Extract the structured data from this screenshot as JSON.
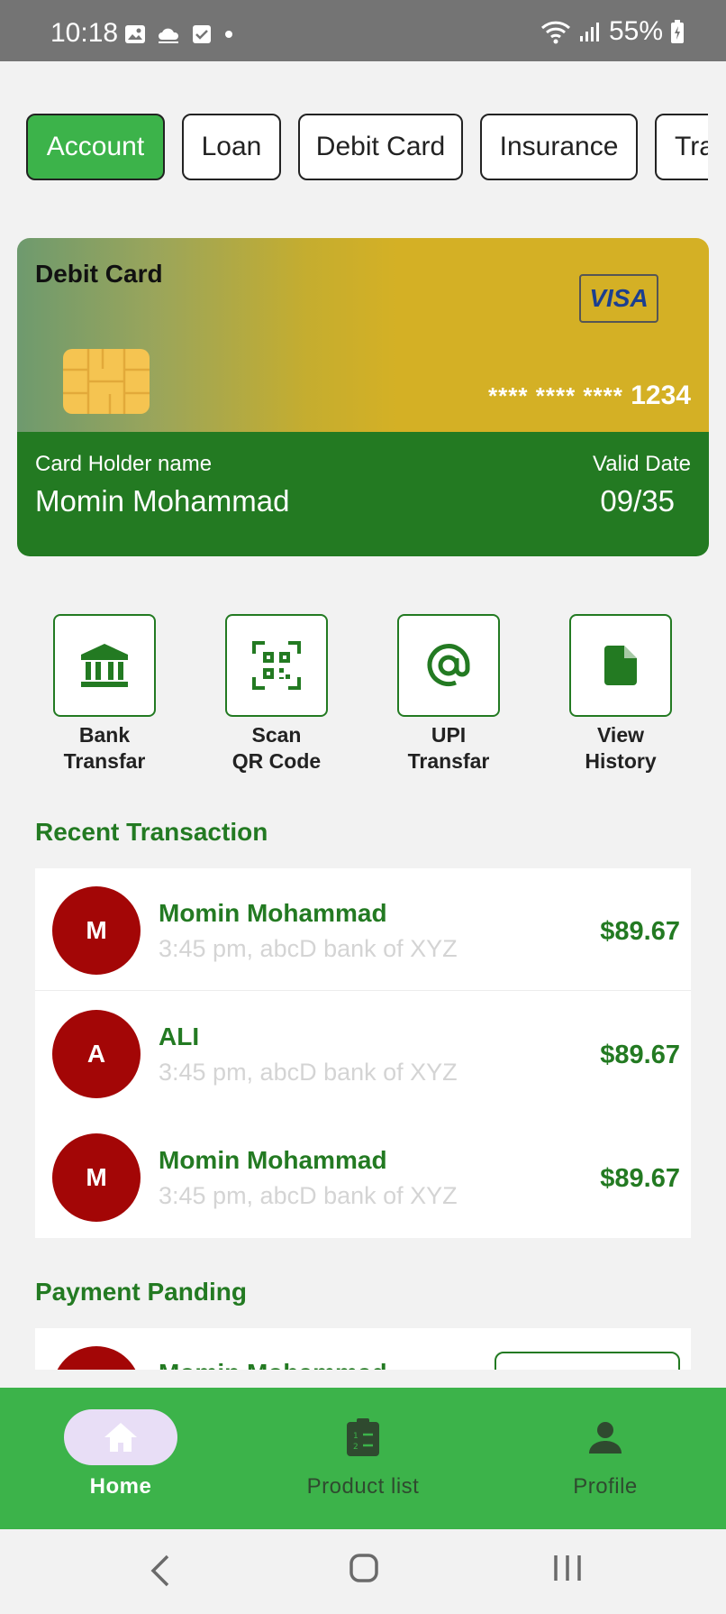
{
  "status_bar": {
    "time": "10:18",
    "battery": "55%"
  },
  "tabs": [
    {
      "label": "Account"
    },
    {
      "label": "Loan"
    },
    {
      "label": "Debit Card"
    },
    {
      "label": "Insurance"
    },
    {
      "label": "Tra"
    }
  ],
  "card": {
    "title": "Debit Card",
    "brand": "VISA",
    "masked": "**** **** ****",
    "last4": "1234",
    "holder_label": "Card Holder name",
    "holder_name": "Momin Mohammad",
    "valid_label": "Valid Date",
    "valid_value": "09/35"
  },
  "actions": [
    {
      "label": "Bank\nTransfar",
      "icon": "bank-icon"
    },
    {
      "label": "Scan\nQR Code",
      "icon": "qr-code-icon"
    },
    {
      "label": "UPI\nTransfar",
      "icon": "at-icon"
    },
    {
      "label": "View\nHistory",
      "icon": "file-icon"
    }
  ],
  "recent": {
    "title": "Recent Transaction",
    "items": [
      {
        "initial": "M",
        "name": "Momin Mohammad",
        "sub": "3:45 pm, abcD bank of XYZ",
        "amount": "$89.67"
      },
      {
        "initial": "A",
        "name": "ALI",
        "sub": "3:45 pm, abcD bank of XYZ",
        "amount": "$89.67"
      },
      {
        "initial": "M",
        "name": "Momin Mohammad",
        "sub": "3:45 pm, abcD bank of XYZ",
        "amount": "$89.67"
      }
    ]
  },
  "pending": {
    "title": "Payment Panding",
    "first_name": "Momin Mohammad"
  },
  "bottom_nav": [
    {
      "label": "Home",
      "icon": "home-icon"
    },
    {
      "label": "Product list",
      "icon": "clipboard-list-icon"
    },
    {
      "label": "Profile",
      "icon": "person-icon"
    }
  ],
  "colors": {
    "primary_green": "#3cb34a",
    "dark_green": "#237a22",
    "avatar_red": "#a30606",
    "gold": "#d4b025"
  }
}
